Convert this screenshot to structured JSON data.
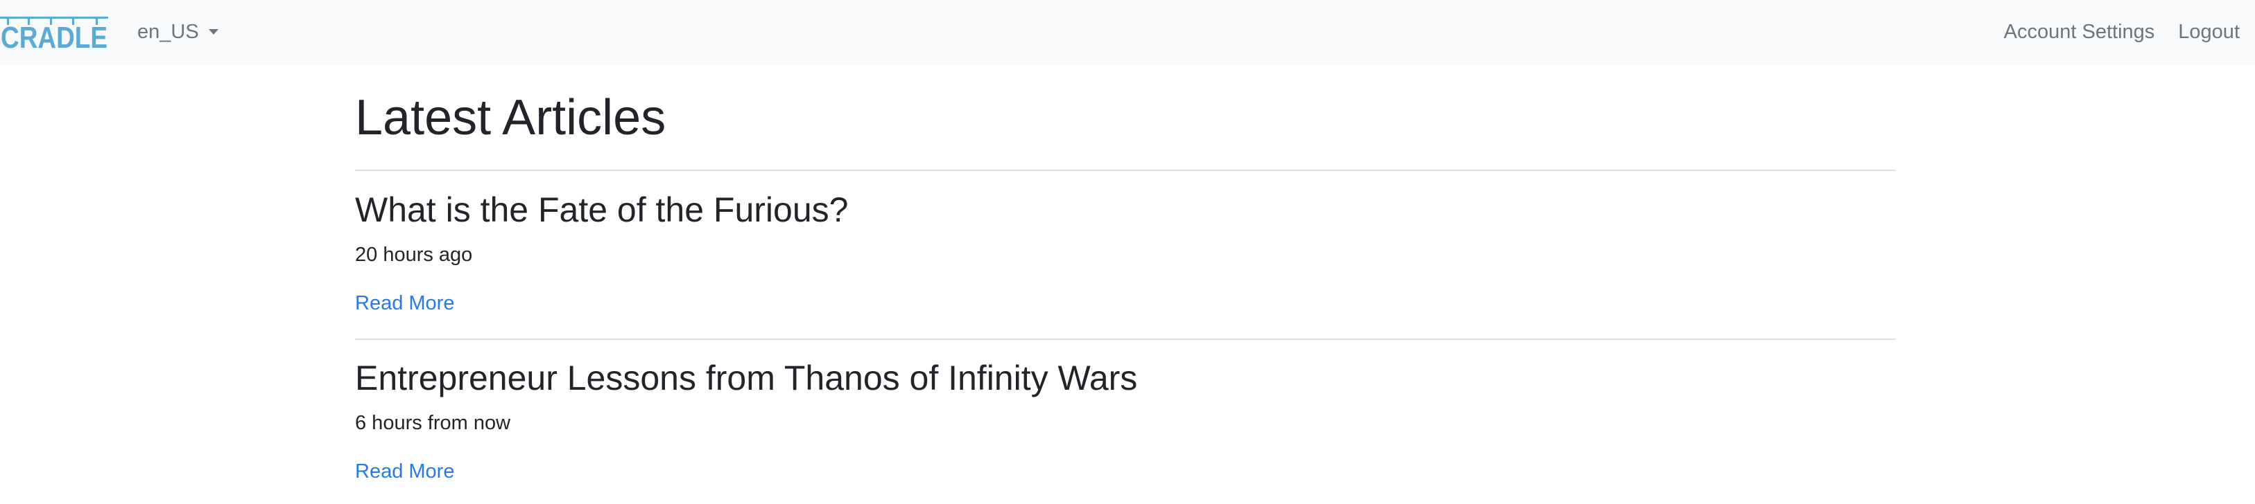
{
  "navbar": {
    "logo_text": "CRADLE",
    "locale_label": "en_US",
    "account_settings_label": "Account Settings",
    "logout_label": "Logout"
  },
  "main": {
    "title": "Latest Articles",
    "articles": [
      {
        "title": "What is the Fate of the Furious?",
        "time": "20 hours ago",
        "read_more_label": "Read More"
      },
      {
        "title": "Entrepreneur Lessons from Thanos of Infinity Wars",
        "time": "6 hours from now",
        "read_more_label": "Read More"
      }
    ]
  },
  "colors": {
    "navbar_bg": "#f8f9fa",
    "logo_blue": "#5aaad8",
    "link_blue": "#2779e6",
    "nav_text": "#6c757d",
    "divider": "#dee2e6"
  }
}
